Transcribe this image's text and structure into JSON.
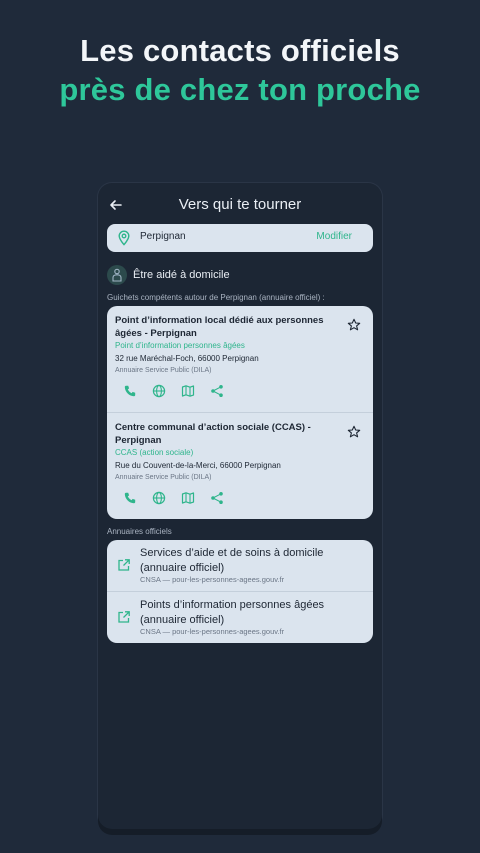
{
  "promo": {
    "line1": "Les contacts officiels",
    "line2": "près de chez ton proche"
  },
  "header": {
    "title": "Vers qui te tourner",
    "back_icon": "arrow-left-icon"
  },
  "location": {
    "city": "Perpignan",
    "action": "Modifier"
  },
  "section": {
    "title": "Être aidé à domicile",
    "icon": "helper-person-icon"
  },
  "guichets_caption": "Guichets compétents autour de Perpignan (annuaire officiel) :",
  "guichets": [
    {
      "name": "Point d’information local dédié aux personnes âgées - Perpignan",
      "category": "Point d’information personnes âgées",
      "address": "32 rue Maréchal-Foch, 66000 Perpignan",
      "source": "Annuaire Service Public (DILA)"
    },
    {
      "name": "Centre communal d’action sociale (CCAS) - Perpignan",
      "category": "CCAS (action sociale)",
      "address": "Rue du Couvent-de-la-Merci, 66000 Perpignan",
      "source": "Annuaire Service Public (DILA)"
    }
  ],
  "annuaires_caption": "Annuaires officiels",
  "annuaires": [
    {
      "name": "Services d’aide et de soins à domicile (annuaire officiel)",
      "source": "CNSA — pour-les-personnes-agees.gouv.fr"
    },
    {
      "name": "Points d’information personnes âgées (annuaire officiel)",
      "source": "CNSA — pour-les-personnes-agees.gouv.fr"
    }
  ],
  "colors": {
    "accent": "#2ec79a",
    "background": "#1f2a3a",
    "card": "#dbe4ee"
  }
}
